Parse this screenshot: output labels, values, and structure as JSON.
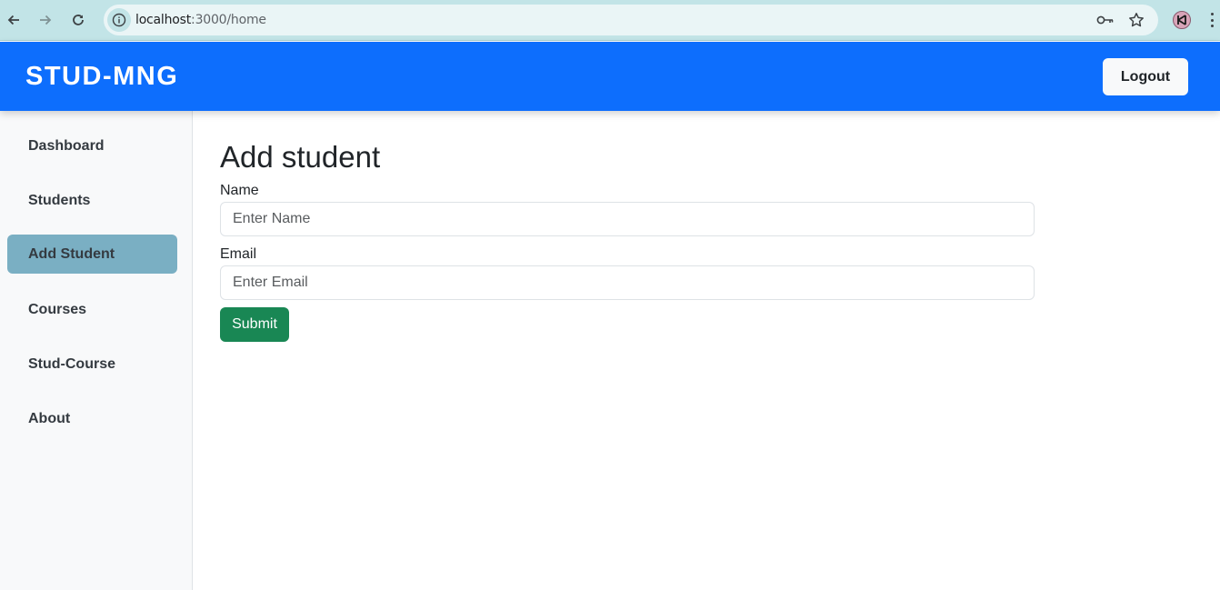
{
  "browser": {
    "url_host": "localhost",
    "url_rest": ":3000/home"
  },
  "header": {
    "brand": "STUD-MNG",
    "logout_label": "Logout",
    "color": "#0d6efd"
  },
  "sidebar": {
    "items": [
      {
        "label": "Dashboard",
        "active": false
      },
      {
        "label": "Students",
        "active": false
      },
      {
        "label": "Add Student",
        "active": true
      },
      {
        "label": "Courses",
        "active": false
      },
      {
        "label": "Stud-Course",
        "active": false
      },
      {
        "label": "About",
        "active": false
      }
    ],
    "active_color": "#7aafc3"
  },
  "form": {
    "title": "Add student",
    "name_label": "Name",
    "name_value": "",
    "name_placeholder": "Enter Name",
    "email_label": "Email",
    "email_value": "",
    "email_placeholder": "Enter Email",
    "submit_label": "Submit",
    "submit_color": "#198754"
  },
  "icons": {
    "back": "arrow-left-icon",
    "forward": "arrow-right-icon",
    "reload": "reload-icon",
    "site_info": "info-icon",
    "password": "key-icon",
    "bookmark": "star-icon",
    "menu": "kebab-menu-icon"
  }
}
